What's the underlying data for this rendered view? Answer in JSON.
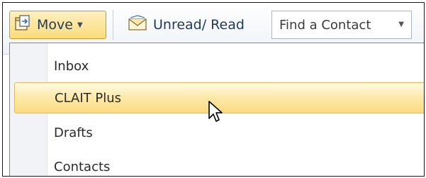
{
  "toolbar": {
    "move_label": "Move",
    "unread_read_label": "Unread/ Read",
    "find_contact_value": "Find a Contact"
  },
  "menu": {
    "items": [
      {
        "label": "Inbox",
        "highlighted": false
      },
      {
        "label": "CLAIT Plus",
        "highlighted": true
      },
      {
        "label": "Drafts",
        "highlighted": false
      },
      {
        "label": "Contacts",
        "highlighted": false
      }
    ]
  },
  "icons": {
    "move": "move-to-folder-icon",
    "unread_read": "envelope-icon",
    "dropdown": "dropdown-arrow-icon",
    "cursor": "mouse-pointer-icon"
  },
  "colors": {
    "highlight": "#fde9a6",
    "highlight_border": "#e2b95e",
    "move_button_bg": "#fbdc7a",
    "text": "#1e395b"
  }
}
